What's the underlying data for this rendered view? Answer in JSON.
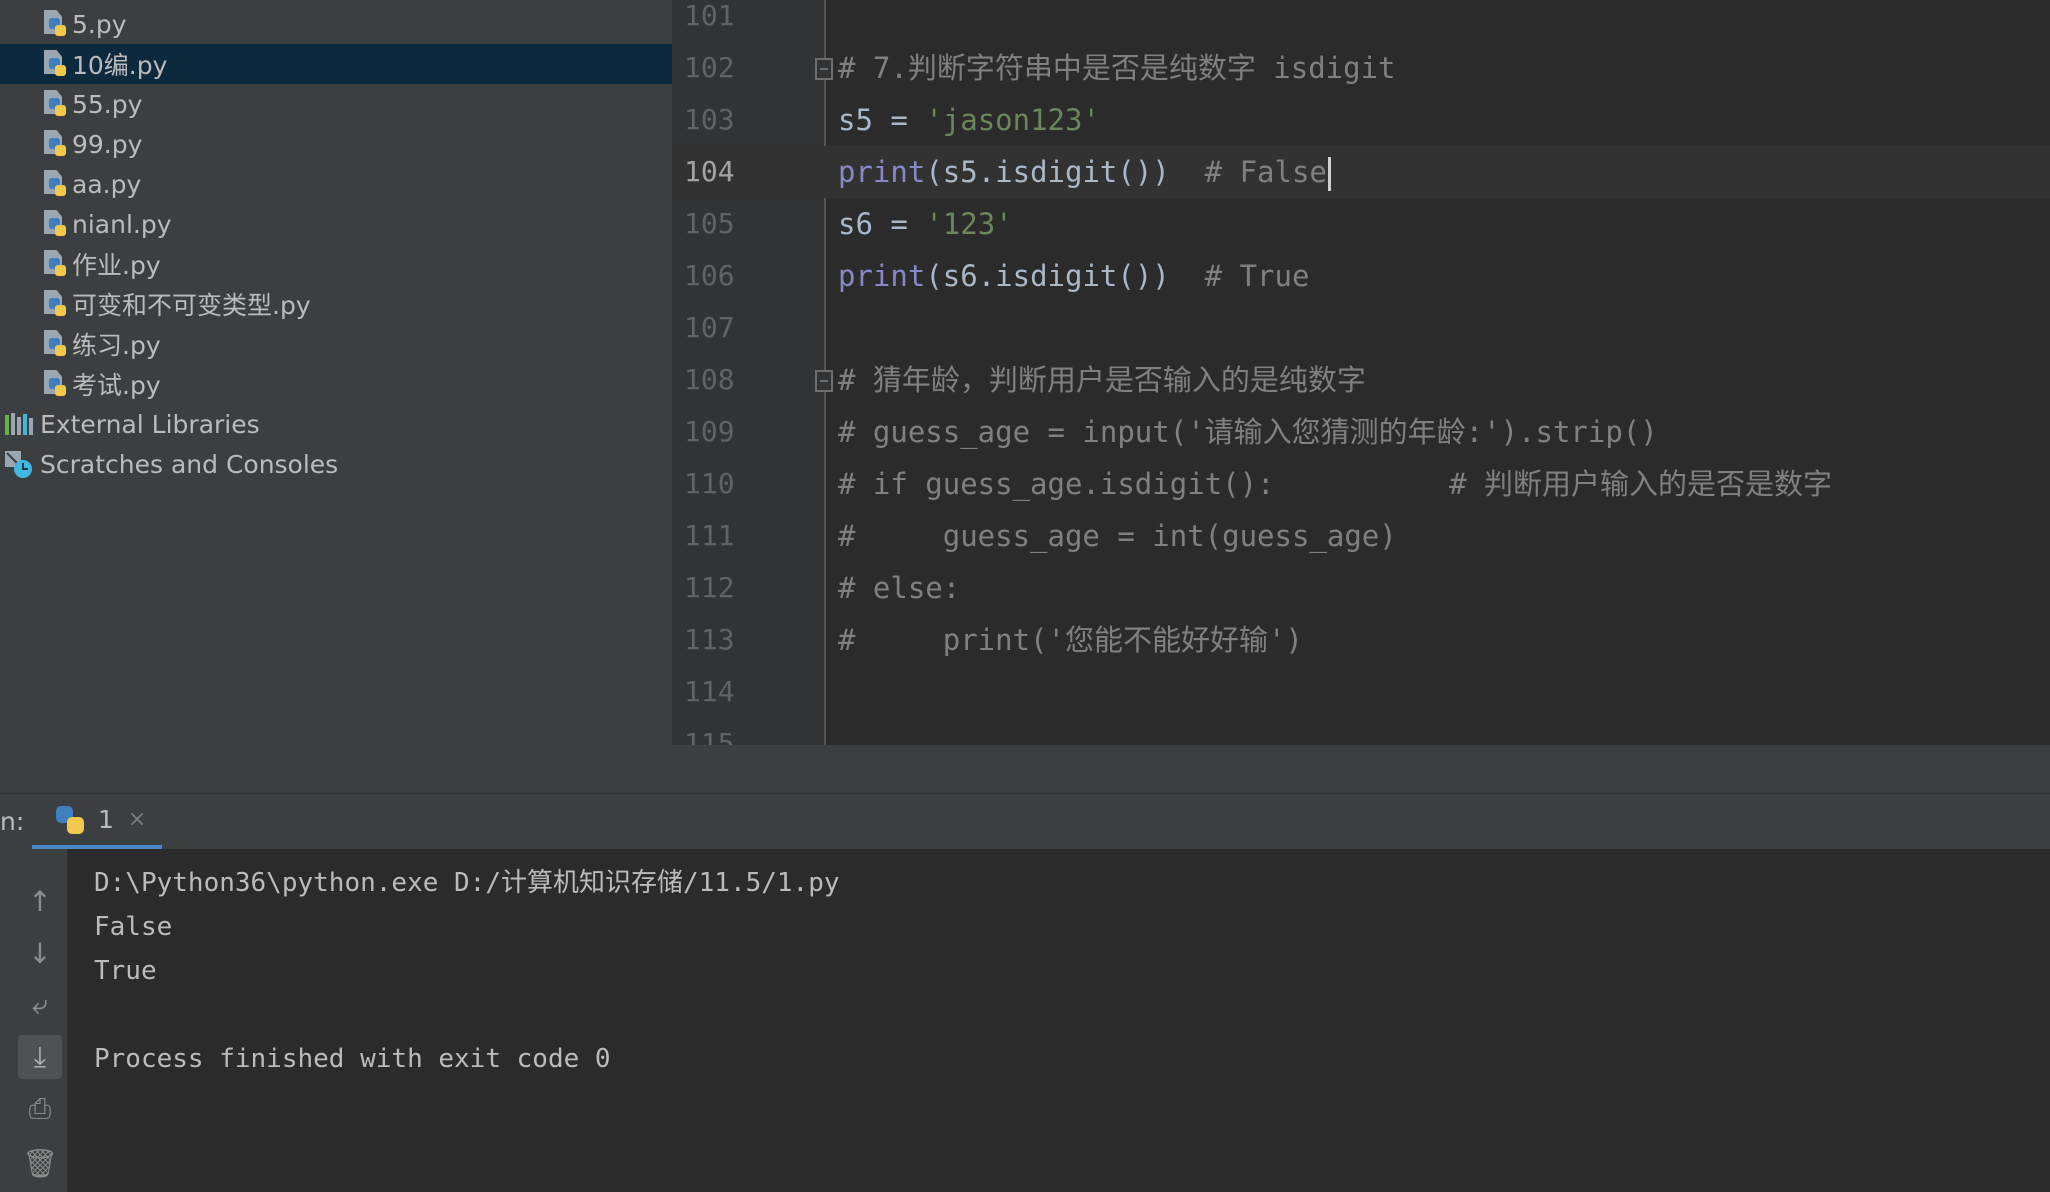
{
  "project_tree": {
    "items": [
      {
        "label": "5.py",
        "type": "python-file",
        "selected": false
      },
      {
        "label": "10编.py",
        "type": "python-file",
        "selected": true
      },
      {
        "label": "55.py",
        "type": "python-file",
        "selected": false
      },
      {
        "label": "99.py",
        "type": "python-file",
        "selected": false
      },
      {
        "label": "aa.py",
        "type": "python-file",
        "selected": false
      },
      {
        "label": "nianl.py",
        "type": "python-file",
        "selected": false
      },
      {
        "label": "作业.py",
        "type": "python-file",
        "selected": false
      },
      {
        "label": "可变和不可变类型.py",
        "type": "python-file",
        "selected": false
      },
      {
        "label": "练习.py",
        "type": "python-file",
        "selected": false
      },
      {
        "label": "考试.py",
        "type": "python-file",
        "selected": false
      },
      {
        "label": "External Libraries",
        "type": "libraries",
        "selected": false
      },
      {
        "label": "Scratches and Consoles",
        "type": "scratches",
        "selected": false
      }
    ]
  },
  "editor": {
    "current_line": "104",
    "lines": [
      {
        "num": "101",
        "tokens": []
      },
      {
        "num": "102",
        "fold": true,
        "tokens": [
          {
            "t": "# 7.判断字符串中是否是纯数字 isdigit",
            "c": "comment"
          }
        ]
      },
      {
        "num": "103",
        "tokens": [
          {
            "t": "s5 = ",
            "c": "plain"
          },
          {
            "t": "'jason123'",
            "c": "string"
          }
        ]
      },
      {
        "num": "104",
        "caret": true,
        "tokens": [
          {
            "t": "print",
            "c": "builtin"
          },
          {
            "t": "(s5.isdigit())  ",
            "c": "plain"
          },
          {
            "t": "# False",
            "c": "comment"
          }
        ]
      },
      {
        "num": "105",
        "tokens": [
          {
            "t": "s6 = ",
            "c": "plain"
          },
          {
            "t": "'123'",
            "c": "string"
          }
        ]
      },
      {
        "num": "106",
        "tokens": [
          {
            "t": "print",
            "c": "builtin"
          },
          {
            "t": "(s6.isdigit())  ",
            "c": "plain"
          },
          {
            "t": "# True",
            "c": "comment"
          }
        ]
      },
      {
        "num": "107",
        "tokens": []
      },
      {
        "num": "108",
        "fold": true,
        "tokens": [
          {
            "t": "# 猜年龄，判断用户是否输入的是纯数字",
            "c": "comment"
          }
        ]
      },
      {
        "num": "109",
        "tokens": [
          {
            "t": "# guess_age = input('请输入您猜测的年龄:').strip()",
            "c": "comment"
          }
        ]
      },
      {
        "num": "110",
        "tokens": [
          {
            "t": "# if guess_age.isdigit():          # 判断用户输入的是否是数字",
            "c": "comment"
          }
        ]
      },
      {
        "num": "111",
        "tokens": [
          {
            "t": "#     guess_age = int(guess_age)",
            "c": "comment"
          }
        ]
      },
      {
        "num": "112",
        "tokens": [
          {
            "t": "# else:",
            "c": "comment"
          }
        ]
      },
      {
        "num": "113",
        "tokens": [
          {
            "t": "#     print('您能不能好好输')",
            "c": "comment"
          }
        ]
      },
      {
        "num": "114",
        "tokens": []
      },
      {
        "num": "115",
        "tokens": []
      }
    ]
  },
  "run_panel": {
    "title": "n:",
    "tab_label": "1",
    "tab_close": "×",
    "tools": [
      {
        "name": "up-arrow-icon",
        "glyph": "↑"
      },
      {
        "name": "down-arrow-icon",
        "glyph": "↓"
      },
      {
        "name": "soft-wrap-icon",
        "glyph": "⤶"
      },
      {
        "name": "scroll-to-end-icon",
        "glyph": "⤓"
      },
      {
        "name": "print-icon",
        "glyph": "⎙"
      },
      {
        "name": "trash-icon",
        "glyph": "🗑"
      }
    ],
    "output": [
      "D:\\Python36\\python.exe D:/计算机知识存储/11.5/1.py",
      "False",
      "True",
      "",
      "Process finished with exit code 0"
    ]
  },
  "colors": {
    "builtin": "#8888c6",
    "string": "#6a8759",
    "comment": "#808080",
    "plain": "#a9b7c6",
    "selection": "#0d293e"
  }
}
